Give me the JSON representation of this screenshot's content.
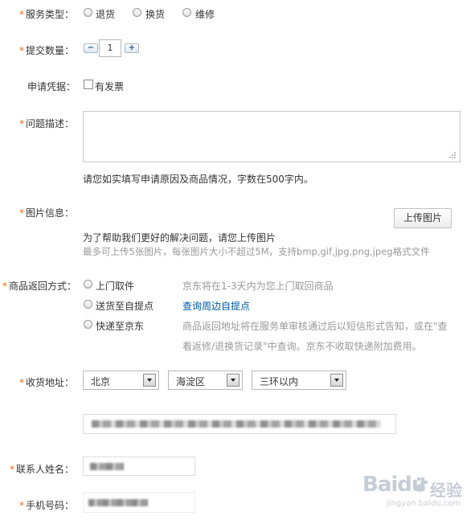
{
  "service_type": {
    "label": "服务类型：",
    "options": [
      "退货",
      "换货",
      "维修"
    ]
  },
  "quantity": {
    "label": "提交数量：",
    "value": "1",
    "minus": "−",
    "plus": "+"
  },
  "receipt": {
    "label": "申请凭据：",
    "checkbox_label": "有发票"
  },
  "description": {
    "label": "问题描述：",
    "hint": "请您如实填写申请原因及商品情况，字数在500字内。"
  },
  "images": {
    "label": "图片信息：",
    "upload_button": "上传图片",
    "hint_main": "为了帮助我们更好的解决问题，请您上传图片",
    "hint_sub": "最多可上传5张图片，每张图片大小不超过5M，支持bmp,gif,jpg,png,jpeg格式文件"
  },
  "return_method": {
    "label": "商品返回方式：",
    "options": [
      {
        "label": "上门取件",
        "desc": "京东将在1-3天内为您上门取回商品"
      },
      {
        "label": "送货至自提点",
        "link": "查询周边自提点"
      },
      {
        "label": "快递至京东",
        "desc_line1": "商品返回地址将在服务单审核通过后以短信形式告知，或在\"查",
        "desc_line2": "看返修/退换货记录\"中查询。京东不收取快递附加费用。"
      }
    ]
  },
  "address": {
    "label": "收货地址：",
    "province": "北京",
    "district": "海淀区",
    "area": "三环以内"
  },
  "contact": {
    "name_label": "联系人姓名：",
    "phone_label": "手机号码："
  },
  "watermark": {
    "brand": "Baidu",
    "cn": "经验",
    "url": "jingyan.baidu.com"
  },
  "colors": {
    "required": "#ff6600",
    "link": "#005aa0",
    "hint_gray": "#999999"
  }
}
